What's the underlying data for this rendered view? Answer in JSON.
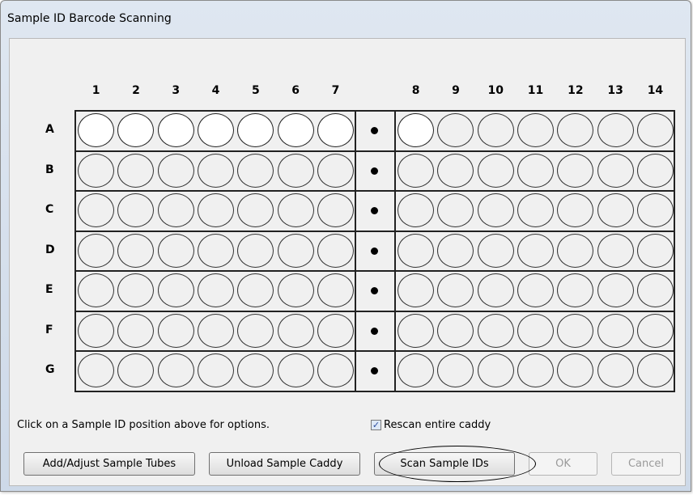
{
  "window": {
    "title": "Sample ID Barcode Scanning"
  },
  "columns": [
    "1",
    "2",
    "3",
    "4",
    "5",
    "6",
    "7",
    "8",
    "9",
    "10",
    "11",
    "12",
    "13",
    "14"
  ],
  "rows": [
    "A",
    "B",
    "C",
    "D",
    "E",
    "F",
    "G"
  ],
  "tube_states": {
    "A": [
      "filled",
      "filled",
      "filled",
      "filled",
      "filled",
      "filled",
      "filled",
      "filled",
      "empty",
      "empty",
      "empty",
      "empty",
      "empty",
      "empty"
    ],
    "B": [
      "empty",
      "empty",
      "empty",
      "empty",
      "empty",
      "empty",
      "empty",
      "empty",
      "empty",
      "empty",
      "empty",
      "empty",
      "empty",
      "empty"
    ],
    "C": [
      "empty",
      "empty",
      "empty",
      "empty",
      "empty",
      "empty",
      "empty",
      "empty",
      "empty",
      "empty",
      "empty",
      "empty",
      "empty",
      "empty"
    ],
    "D": [
      "empty",
      "empty",
      "empty",
      "empty",
      "empty",
      "empty",
      "empty",
      "empty",
      "empty",
      "empty",
      "empty",
      "empty",
      "empty",
      "empty"
    ],
    "E": [
      "empty",
      "empty",
      "empty",
      "empty",
      "empty",
      "empty",
      "empty",
      "empty",
      "empty",
      "empty",
      "empty",
      "empty",
      "empty",
      "empty"
    ],
    "F": [
      "empty",
      "empty",
      "empty",
      "empty",
      "empty",
      "empty",
      "empty",
      "empty",
      "empty",
      "empty",
      "empty",
      "empty",
      "empty",
      "empty"
    ],
    "G": [
      "empty",
      "empty",
      "empty",
      "empty",
      "empty",
      "empty",
      "empty",
      "empty",
      "empty",
      "empty",
      "empty",
      "empty",
      "empty",
      "empty"
    ]
  },
  "hint": "Click on a Sample ID position above for options.",
  "rescan": {
    "label": "Rescan entire caddy",
    "checked": true
  },
  "buttons": {
    "add_adjust": "Add/Adjust Sample Tubes",
    "unload": "Unload Sample Caddy",
    "scan": "Scan Sample IDs",
    "ok": "OK",
    "cancel": "Cancel"
  }
}
